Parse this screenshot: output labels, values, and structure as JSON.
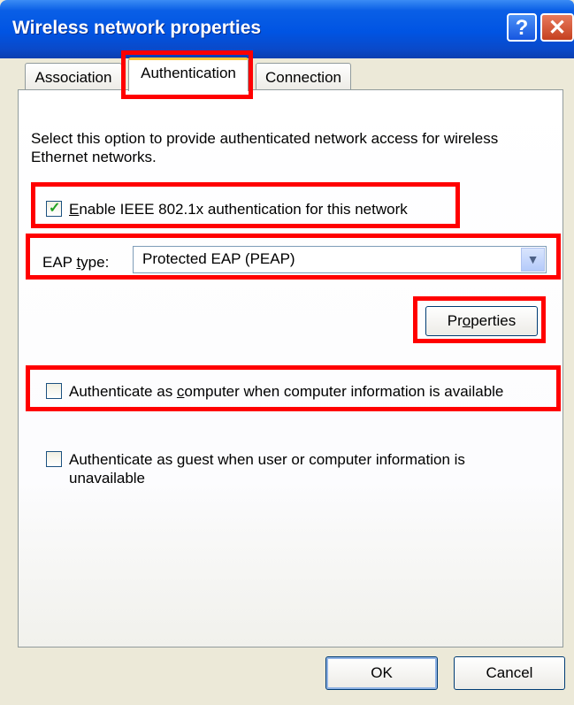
{
  "window": {
    "title": "Wireless network properties",
    "help_symbol": "?",
    "close_symbol": "✕"
  },
  "tabs": [
    {
      "label": "Association",
      "selected": false
    },
    {
      "label": "Authentication",
      "selected": true
    },
    {
      "label": "Connection",
      "selected": false
    }
  ],
  "authentication": {
    "description": "Select this option to provide authenticated network access for wireless Ethernet networks.",
    "enable_8021x": {
      "label_prefix": "",
      "accel": "E",
      "label_rest": "nable IEEE 802.1x authentication for this network",
      "checked": true
    },
    "eap_type": {
      "label_prefix": "EAP ",
      "accel": "t",
      "label_rest": "ype:",
      "value": "Protected EAP (PEAP)"
    },
    "properties_button": {
      "prefix": "Pr",
      "accel": "o",
      "rest": "perties"
    },
    "auth_as_computer": {
      "prefix": "Authenticate as ",
      "accel": "c",
      "rest": "omputer when computer information is available",
      "checked": false
    },
    "auth_as_guest": {
      "prefix": "Authenticate as ",
      "accel": "g",
      "rest": "uest when user or computer information is unavailable",
      "checked": false
    }
  },
  "footer": {
    "ok_label": "OK",
    "cancel_label": "Cancel"
  },
  "colors": {
    "titlebar": "#0054e3",
    "highlight_border": "#ff0000",
    "checkmark": "#21a121"
  }
}
